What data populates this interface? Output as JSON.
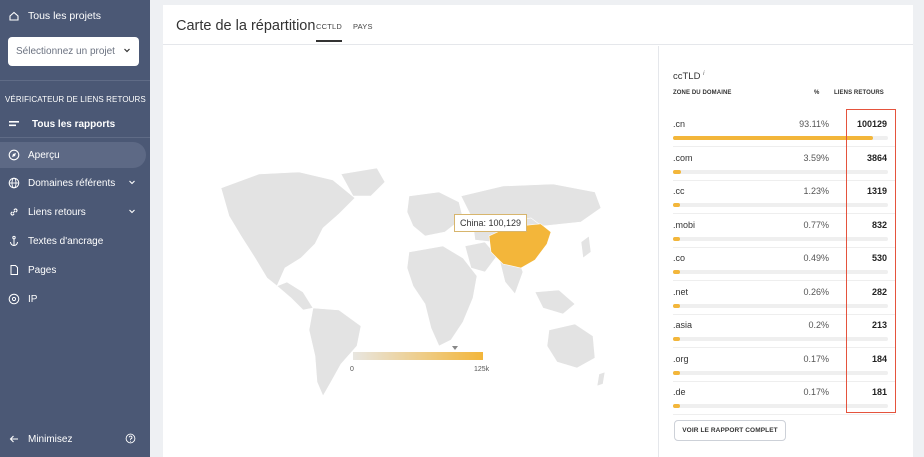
{
  "sidebar": {
    "all_projects": "Tous les projets",
    "project_select_placeholder": "Sélectionnez un projet",
    "section_title": "VÉRIFICATEUR DE LIENS RETOURS",
    "items": [
      {
        "label": "Tous les rapports",
        "icon": "menu-icon"
      },
      {
        "label": "Aperçu",
        "icon": "compass-icon"
      },
      {
        "label": "Domaines référents",
        "icon": "globe-icon"
      },
      {
        "label": "Liens retours",
        "icon": "link-icon"
      },
      {
        "label": "Textes d'ancrage",
        "icon": "anchor-icon"
      },
      {
        "label": "Pages",
        "icon": "page-icon"
      },
      {
        "label": "IP",
        "icon": "ip-icon"
      }
    ],
    "minimize": "Minimisez"
  },
  "main": {
    "title": "Carte de la répartition",
    "tabs": [
      {
        "label": "CCTLD",
        "active": true
      },
      {
        "label": "PAYS",
        "active": false
      }
    ]
  },
  "map": {
    "tooltip": "China: 100,129",
    "legend_min": "0",
    "legend_max": "125k",
    "highlight_color": "#f3b63a"
  },
  "table": {
    "title": "ccTLD",
    "info": "i",
    "columns": [
      "ZONE DU DOMAINE",
      "%",
      "LIENS RETOURS"
    ],
    "rows": [
      {
        "domain": ".cn",
        "percent": "93.11%",
        "count": "100129",
        "share": 93.11
      },
      {
        "domain": ".com",
        "percent": "3.59%",
        "count": "3864",
        "share": 3.59
      },
      {
        "domain": ".cc",
        "percent": "1.23%",
        "count": "1319",
        "share": 1.23
      },
      {
        "domain": ".mobi",
        "percent": "0.77%",
        "count": "832",
        "share": 0.77
      },
      {
        "domain": ".co",
        "percent": "0.49%",
        "count": "530",
        "share": 0.49
      },
      {
        "domain": ".net",
        "percent": "0.26%",
        "count": "282",
        "share": 0.26
      },
      {
        "domain": ".asia",
        "percent": "0.2%",
        "count": "213",
        "share": 0.2
      },
      {
        "domain": ".org",
        "percent": "0.17%",
        "count": "184",
        "share": 0.17
      },
      {
        "domain": ".de",
        "percent": "0.17%",
        "count": "181",
        "share": 0.17
      }
    ],
    "full_report_button": "VOIR LE RAPPORT COMPLET"
  }
}
